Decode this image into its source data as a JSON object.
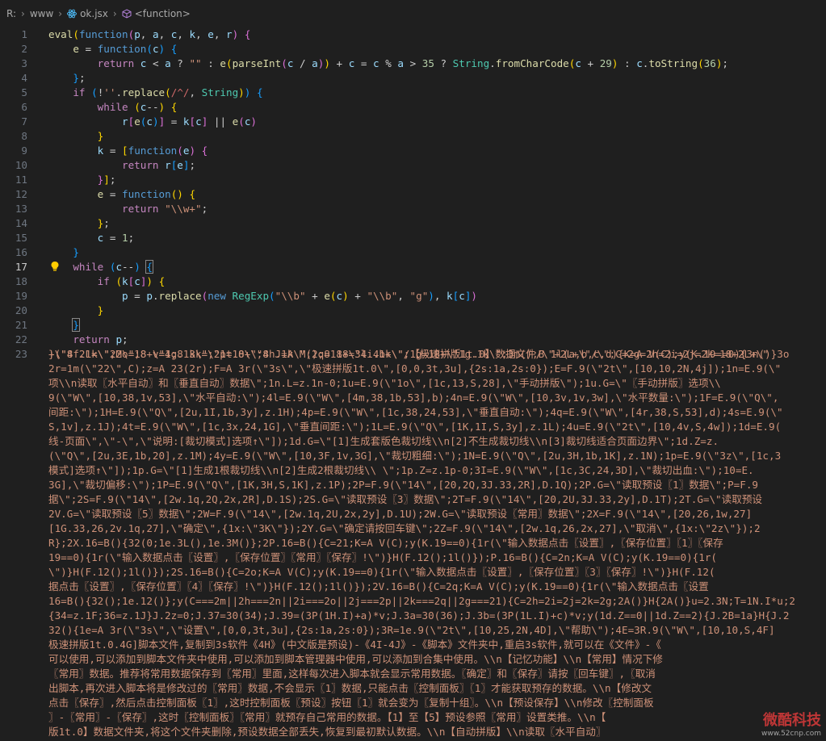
{
  "breadcrumb": {
    "drive": "R:",
    "folder": "www",
    "file": "ok.jsx",
    "symbol": "<function>"
  },
  "gutter": [
    "1",
    "2",
    "3",
    "4",
    "5",
    "6",
    "7",
    "8",
    "9",
    "10",
    "11",
    "12",
    "13",
    "14",
    "15",
    "16",
    "17",
    "18",
    "19",
    "20",
    "21",
    "22",
    "23"
  ],
  "code_lines": [
    "eval(function(p, a, c, k, e, r) {",
    "    e = function(c) {",
    "        return c < a ? \"\" : e(parseInt(c / a)) + c = c % a > 35 ? String.fromCharCode(c + 29) : c.toString(36);",
    "    };",
    "    if (!''.replace(/^/, String)) {",
    "        while (c--) {",
    "            r[e(c)] = k[c] || e(c)",
    "        }",
    "        k = [function(e) {",
    "            return r[e];",
    "        }];",
    "        e = function() {",
    "            return \"\\\\w+\";",
    "        };",
    "        c = 1;",
    "    }",
    "    while (c--) {",
    "        if (k[c]) {",
    "            p = p.replace(new RegExp(\"\\\\b\" + e(c) + \"\\\\b\", \"g\"), k[c])",
    "        }",
    "    }",
    "    return p;",
    "}(\"8 2L=\\\"2M\\\";8 v=1;8 3k=\\\"1t.0\\\";8 J=A M();8 18=3l.4b+\\\"/【极速拼版1t.0】数据文件/\\\"+2L+\\\"/\\\";C=2g=2h=2i=2j=2k=18+2L+\\\""
  ],
  "wrapped_lines": [
    "+\\\"4f.1k\\\";2o=18+\\\"4g.1k\\\";2p=18+\\\"4h.1k\\\";2q=18+\\\"4i.1k\\\";1g=18+\\\"1g.1k\\\";3m();B 1l(a,b,c,d){K=A V(C);y(K.19==0){3n()}3o",
    "2r=1m(\\\"22\\\",C);z=A 23(2r);F=A 3r(\\\"3s\\\",\\\"极速拼版1t.0\\\",[0,0,3t,3u],{2s:1a,2s:0});E=F.9(\\\"2t\\\",[10,10,2N,4j]);1n=E.9(\\\"",
    "项\\\\n读取〖水平自动〗和〖垂直自动〗数据\\\";1n.L=z.1n-0;1u=E.9(\\\"1o\\\",[1c,13,S,28],\\\"手动拼版\\\");1u.G=\\\"〖手动拼版〗选项\\\\",
    "9(\\\"W\\\",[10,38,1v,53],\\\"水平自动:\\\");4l=E.9(\\\"W\\\",[4m,38,1b,53],b);4n=E.9(\\\"W\\\",[10,3v,1v,3w],\\\"水平数量:\\\");1F=E.9(\\\"Q\\\",",
    "间距:\\\");1H=E.9(\\\"Q\\\",[2u,1I,1b,3y],z.1H);4p=E.9(\\\"W\\\",[1c,38,24,53],\\\"垂直自动:\\\");4q=E.9(\\\"W\\\",[4r,38,S,53],d);4s=E.9(\\\"",
    "S,1v],z.1J);4t=E.9(\\\"W\\\",[1c,3x,24,1G],\\\"垂直间距:\\\");1L=E.9(\\\"Q\\\",[1K,1I,S,3y],z.1L);4u=E.9(\\\"2t\\\",[10,4v,S,4w]);1d=E.9(",
    "线-页面\\\",\\\"-\\\",\\\"说明:[裁切模式]选项↑\\\"]);1d.G=\\\"[1]生成套版色裁切线\\\\n[2]不生成裁切线\\\\n[3]裁切线适合页面边界\\\";1d.Z=z.",
    "(\\\"Q\\\",[2u,3E,1b,20],z.1M);4y=E.9(\\\"W\\\",[10,3F,1v,3G],\\\"裁切粗细:\\\");1N=E.9(\\\"Q\\\",[2u,3H,1b,1K],z.1N);1p=E.9(\\\"3z\\\",[1c,3",
    "模式]选项↑\\\"]);1p.G=\\\"[1]生成1根裁切线\\\\n[2]生成2根裁切线\\\\ \\\";1p.Z=z.1p-0;3I=E.9(\\\"W\\\",[1c,3C,24,3D],\\\"裁切出血:\\\");10=E.",
    "3G],\\\"裁切偏移:\\\");1P=E.9(\\\"Q\\\",[1K,3H,S,1K],z.1P);2P=F.9(\\\"14\\\",[20,2Q,3J.33,2R],D.1Q);2P.G=\\\"读取预设〖1〗数据\\\";P=F.9",
    "据\\\";2S=F.9(\\\"14\\\",[2w.1q,2Q,2x,2R],D.1S);2S.G=\\\"读取预设〖3〗数据\\\";2T=F.9(\\\"14\\\",[20,2U,3J.33,2y],D.1T);2T.G=\\\"读取预设",
    "2V.G=\\\"读取预设〖5〗数据\\\";2W=F.9(\\\"14\\\",[2w.1q,2U,2x,2y],D.1U);2W.G=\\\"读取预设〖常用〗数据\\\";2X=F.9(\\\"14\\\",[20,26,1w,27]",
    "[1G.33,26,2v.1q,27],\\\"确定\\\",{1x:\\\"3K\\\"});2Y.G=\\\"确定请按回车键\\\";2Z=F.9(\\\"14\\\",[2w.1q,26,2x,27],\\\"取消\\\",{1x:\\\"2z\\\"});2",
    "R};2X.16=B(){32(0;1e.3L(),1e.3M()};2P.16=B(){C=21;K=A V(C);y(K.19==0){1r(\\\"输入数据点击〖设置〗,〖保存位置〗〖1〗〖保存",
    "19==0){1r(\\\"输入数据点击〖设置〗,〖保存位置〗〖常用〗〖保存〗!\\\")}H(F.12();1l()});P.16=B(){C=2n;K=A V(C);y(K.19==0){1r(",
    "\\\")}H(F.12();1l()});2S.16=B(){C=2o;K=A V(C);y(K.19==0){1r(\\\"输入数据点击〖设置〗,〖保存位置〗〖3〗〖保存〗!\\\")}H(F.12(",
    "据点击〖设置〗,〖保存位置〗〖4〗〖保存〗!\\\")}H(F.12();1l()});2V.16=B(){C=2q;K=A V(C);y(K.19==0){1r(\\\"输入数据点击〖设置",
    "16=B(){32();1e.12()};y(C===2m||2h===2n||2i===2o||2j===2p||2k===2q||2g===21){C=2h=2i=2j=2k=2g;2A()}H{2A()}u=2.3N;T=1N.I*u;2",
    "{34=z.1F;36=z.1J}J.2z=0;J.37=30(34);J.39=(3P(1H.I)+a)*v;J.3a=30(36);J.3b=(3P(1L.I)+c)*v;y(1d.Z==0||1d.Z==2){J.2B=1a}H{J.2",
    "32(){1e=A 3r(\\\"3s\\\",\\\"设置\\\",[0,0,3t,3u],{2s:1a,2s:0});3R=1e.9(\\\"2t\\\",[10,25,2N,4D],\\\"帮助\\\");4E=3R.9(\\\"W\\\",[10,10,S,4F]",
    "极速拼版1t.0.4G]脚本文件,复制到3s软件《4H》(中文版是预设)-《4I-4J》-《脚本》文件夹中,重启3s软件,就可以在《文件》-《",
    "可以使用,可以添加到脚本文件夹中使用,可以添加到脚本管理器中使用,可以添加到合集中使用。\\\\n【记忆功能】\\\\n【常用】情况下修",
    "〖常用〗数据。推荐将常用数据保存到〖常用〗里面,这样每次进入脚本就会显示常用数据。〖确定〗和〖保存〗请按〖回车键〗,〖取消",
    "出脚本,再次进入脚本将是修改过的〖常用〗数据,不会显示〖1〗数据,只能点击〖控制面板〗〖1〗才能获取预存的数据。\\\\n【修改文",
    "点击〖保存〗,然后点击控制面板〖1〗,这时控制面板〖预设〗按钮〖1〗就会变为〖复制十组〗。\\\\n【预设保存】\\\\n修改〖控制面板",
    "〗-〖常用〗-〖保存〗,这时〖控制面板〗〖常用〗就预存自己常用的数据。【1】至【5】预设参照〖常用〗设置类推。\\\\n【",
    "版1t.0】数据文件夹,将这个文件夹删除,预设数据全部丢失,恢复到最初默认数据。\\\\n【自动拼版】\\\\n读取〖水平自动〗"
  ],
  "watermark": {
    "title": "微酷科技",
    "sub": "www.52cnp.com"
  },
  "colors": {
    "background": "#1f1f1f",
    "string": "#ce9178",
    "keyword": "#569cd6",
    "control": "#c586c0",
    "function": "#dcdcaa",
    "variable": "#9cdcfe",
    "number": "#b5cea8",
    "type": "#4ec9b0"
  }
}
